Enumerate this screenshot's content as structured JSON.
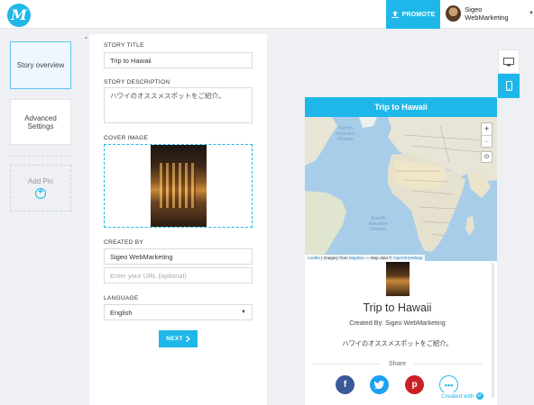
{
  "app": {
    "logo_letter": "M",
    "accent": "#1fb7ea"
  },
  "topbar": {
    "promote_label": "PROMOTE",
    "user_name": "Sigeo WebMarketing"
  },
  "nav": {
    "items": [
      {
        "label": "Story overview",
        "active": true
      },
      {
        "label": "Advanced Settings",
        "active": false
      }
    ],
    "add_pin_label": "Add Pin"
  },
  "form": {
    "story_title_label": "STORY TITLE",
    "story_title_value": "Trip to Hawaii",
    "story_description_label": "STORY DESCRIPTION",
    "story_description_value": "ハワイのオススメスポットをご紹介。",
    "cover_image_label": "COVER IMAGE",
    "created_by_label": "CREATED BY",
    "created_by_value": "Sigeo WebMarketing",
    "url_placeholder": "Enter your URL (optional)",
    "language_label": "LANGUAGE",
    "language_value": "English",
    "next_label": "NEXT"
  },
  "preview": {
    "header_title": "Trip to Hawaii",
    "map": {
      "zoom_in": "+",
      "zoom_out": "−",
      "attribution_leaflet": "Leaflet",
      "attribution_imagery": " | Imagery from ",
      "attribution_mapbox": "MapBox",
      "attribution_mapdata": " — Map data © ",
      "attribution_osm": "OpenStreetMap",
      "north_atlantic": "North\nAtlantic\nOcean",
      "south_atlantic": "South\nAtlantic\nOcean"
    },
    "title": "Trip to Hawaii",
    "created_by": "Created By: Sigeo WebMarketing",
    "description": "ハワイのオススメスポットをご紹介。",
    "share_label": "Share",
    "created_with_label": "Created with"
  },
  "icons": {
    "promote": "upload-icon",
    "desktop": "desktop-icon",
    "mobile": "mobile-icon",
    "add": "plus-circle-icon",
    "next": "chevron-right-icon",
    "select": "chevron-down-icon",
    "locate": "locate-icon",
    "facebook": "facebook-icon",
    "twitter": "twitter-icon",
    "pinterest": "pinterest-icon",
    "more": "more-icon"
  }
}
